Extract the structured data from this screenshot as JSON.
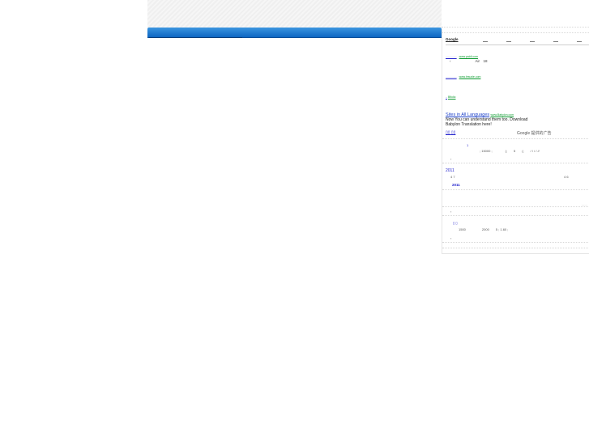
{
  "sidebar": {
    "tabs": {
      "google_label": "Google"
    },
    "ads": [
      {
        "url": "www.paidi.com",
        "text": "Air　18"
      },
      {
        "url": "www.lesuxie.com"
      },
      {
        "url": "Bifolio"
      }
    ],
    "featured_ad": {
      "title": "Sites in All Languages",
      "url": "www.Babylon.com",
      "body_line1": "Now You can understand them too. Download",
      "body_line2": "Babylon Translation here!"
    },
    "feed_icons": "▯▯ ▯▯",
    "google_ads_label": "Google 提供的广告",
    "posts": [
      {
        "marker": "1",
        "line": "; 15000 ;　　　　(;　　5　　(;　　/ / / / //",
        "footer": "‹"
      },
      {
        "year": "2011",
        "line": "4 7",
        "line_right": "4  6",
        "sub_year": "2011"
      },
      {
        "dots": "......",
        "footer": "‹"
      },
      {
        "marker": "▯ ▯",
        "line": "1500　　　　　2000　　5 ; 1.60 ;",
        "footer": "‹"
      }
    ]
  }
}
